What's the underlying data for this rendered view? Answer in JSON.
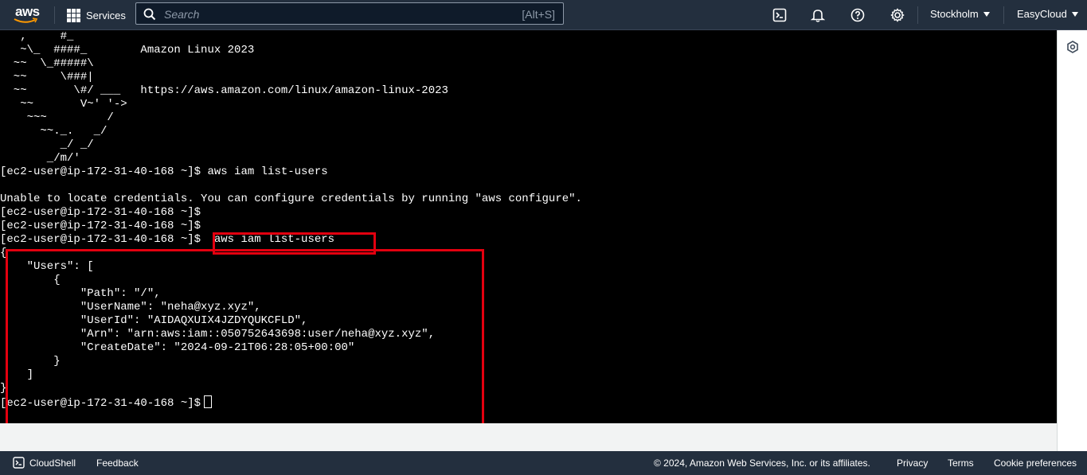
{
  "topnav": {
    "logo_text": "aws",
    "services_label": "Services",
    "search_placeholder": "Search",
    "search_shortcut": "[Alt+S]",
    "icons": [
      "cloudshell-icon",
      "bell-icon",
      "help-icon",
      "gear-icon"
    ],
    "region": "Stockholm",
    "account": "EasyCloud"
  },
  "terminal": {
    "lines": [
      "   ,     #_",
      "   ~\\_  ####_        Amazon Linux 2023",
      "  ~~  \\_#####\\",
      "  ~~     \\###|",
      "  ~~       \\#/ ___   https://aws.amazon.com/linux/amazon-linux-2023",
      "   ~~       V~' '->",
      "    ~~~         /",
      "      ~~._.   _/",
      "         _/ _/",
      "       _/m/'",
      "[ec2-user@ip-172-31-40-168 ~]$ aws iam list-users",
      "",
      "Unable to locate credentials. You can configure credentials by running \"aws configure\".",
      "[ec2-user@ip-172-31-40-168 ~]$",
      "[ec2-user@ip-172-31-40-168 ~]$",
      "[ec2-user@ip-172-31-40-168 ~]$  aws iam list-users",
      "{",
      "    \"Users\": [",
      "        {",
      "            \"Path\": \"/\",",
      "            \"UserName\": \"neha@xyz.xyz\",",
      "            \"UserId\": \"AIDAQXUIX4JZDYQUKCFLD\",",
      "            \"Arn\": \"arn:aws:iam::050752643698:user/neha@xyz.xyz\",",
      "            \"CreateDate\": \"2024-09-21T06:28:05+00:00\"",
      "        }",
      "    ]",
      "}"
    ],
    "prompt": "[ec2-user@ip-172-31-40-168 ~]$"
  },
  "highlight_color": "#e3000f",
  "rail": {
    "icon": "settings-hex-icon"
  },
  "footer": {
    "cloudshell_label": "CloudShell",
    "feedback_label": "Feedback",
    "copyright": "© 2024, Amazon Web Services, Inc. or its affiliates.",
    "privacy_label": "Privacy",
    "terms_label": "Terms",
    "cookie_label": "Cookie preferences"
  }
}
